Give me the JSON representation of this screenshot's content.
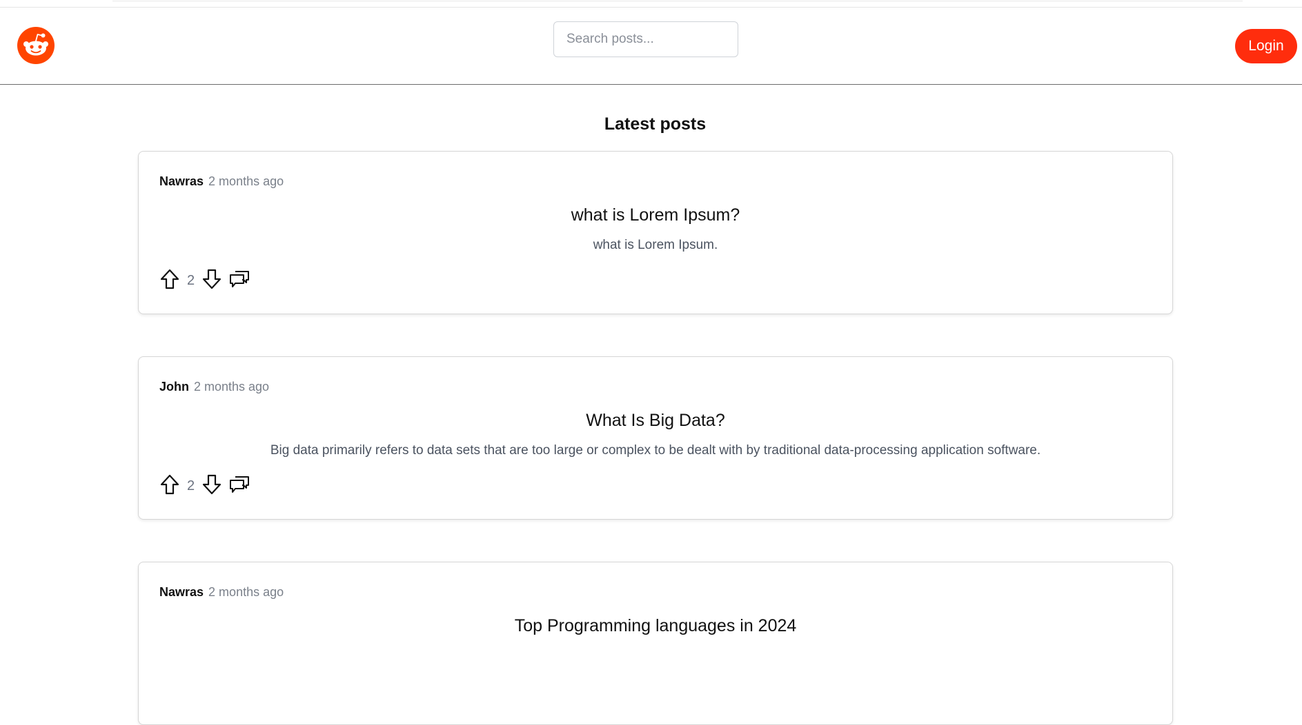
{
  "header": {
    "logo_icon": "reddit-logo-icon",
    "brand_color": "#ff4500",
    "search_placeholder": "Search posts...",
    "login_label": "Login",
    "login_color": "#ff2d0d"
  },
  "feed": {
    "title": "Latest posts",
    "posts": [
      {
        "author": "Nawras",
        "time": "2 months ago",
        "title": "what is Lorem Ipsum?",
        "body": "what is Lorem Ipsum.",
        "votes": "2"
      },
      {
        "author": "John",
        "time": "2 months ago",
        "title": "What Is Big Data?",
        "body": "Big data primarily refers to data sets that are too large or complex to be dealt with by traditional data-processing application software.",
        "votes": "2"
      },
      {
        "author": "Nawras",
        "time": "2 months ago",
        "title": "Top Programming languages in 2024",
        "body": "",
        "votes": ""
      }
    ]
  }
}
